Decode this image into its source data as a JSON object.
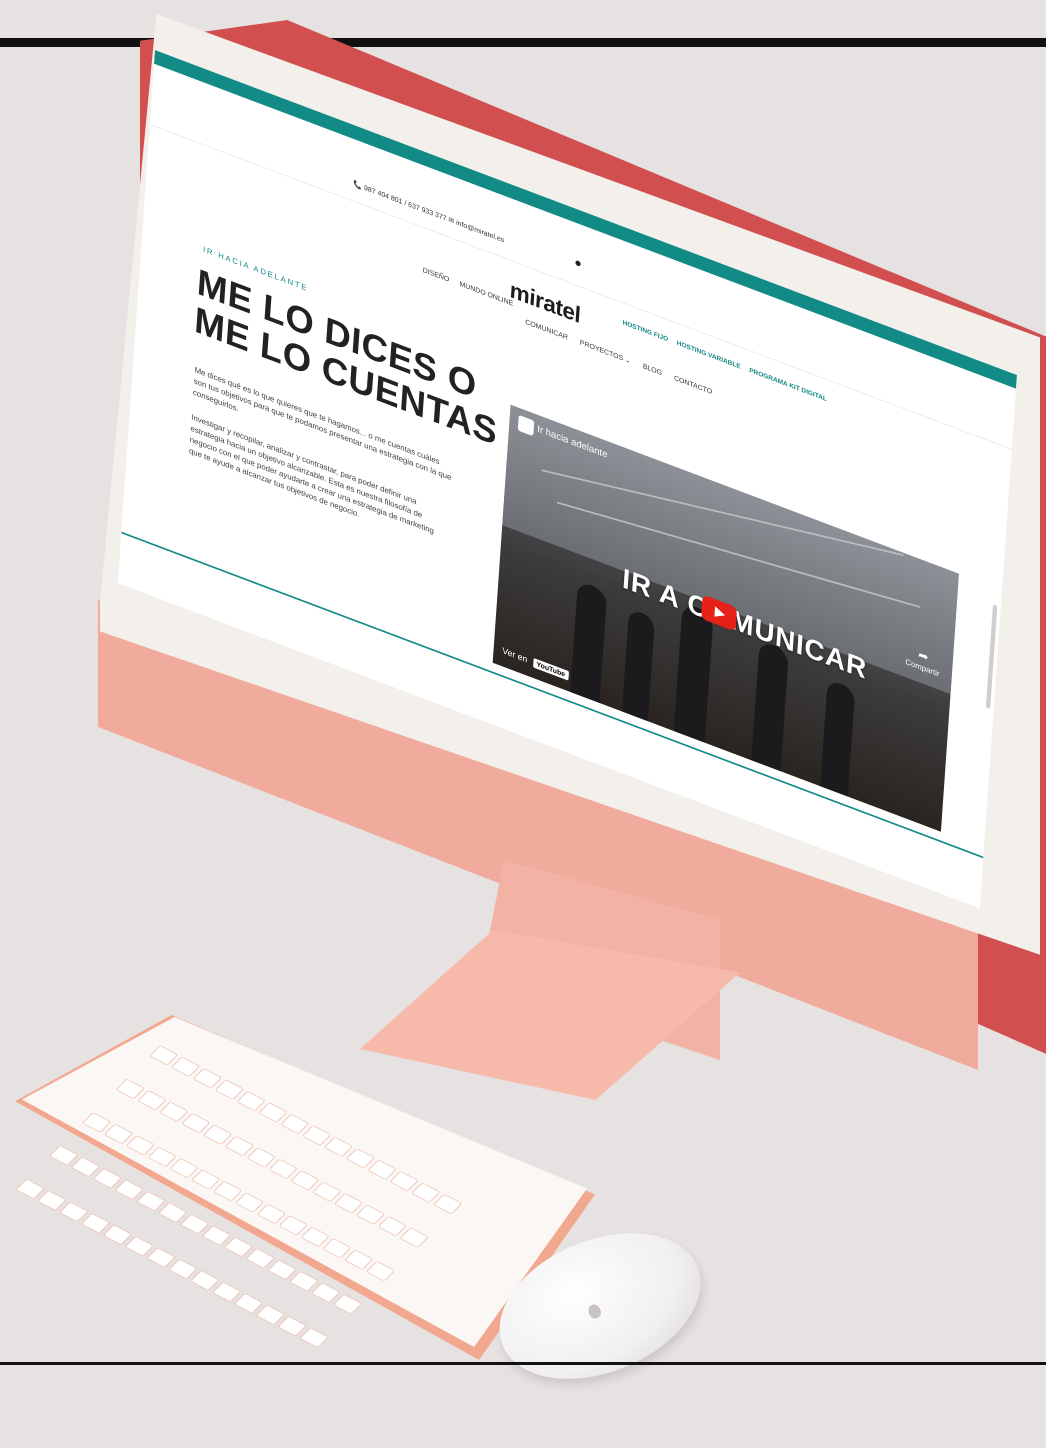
{
  "screen": {
    "contact": "📞 987 404 801 / 637 933 377   ✉ info@miratel.es",
    "logo": "miratel",
    "nav_left": [
      "DISEÑO",
      "MUNDO ONLINE",
      "COMUNICAR",
      "PROYECTOS ⌄",
      "BLOG",
      "CONTACTO"
    ],
    "nav_right": [
      "HOSTING FIJO",
      "HOSTING VARIABLE",
      "PROGRAMA KIT DIGITAL"
    ],
    "kicker": "IR HACIA ADELANTE",
    "headline_1": "ME LO DICES O",
    "headline_2": "ME LO CUENTAS",
    "paragraph_1": "Me dices qué es lo que quieres que te hagamos... o me cuentas cuáles son tus objetivos para que te podamos presentar una estrategia con la que conseguirlos.",
    "paragraph_2": "Investigar y recopilar, analizar y contrastar, para poder definir una estrategia hacia un objetivo alcanzable. Esta es nuestra filosofía de negocio con el que poder ayudarte a crear una estrategia de marketing que te ayude a alcanzar tus objetivos de negocio.",
    "video": {
      "title": "Ir hacia adelante",
      "overlay_text": "IR A COMUNICAR",
      "share_label": "Compartir",
      "watch_label": "Ver en",
      "youtube_label": "YouTube"
    }
  },
  "colors": {
    "teal": "#128a85",
    "imac_pink": "#f1ab9c",
    "imac_red_edge": "#d24f4f",
    "play_red": "#e62117"
  }
}
